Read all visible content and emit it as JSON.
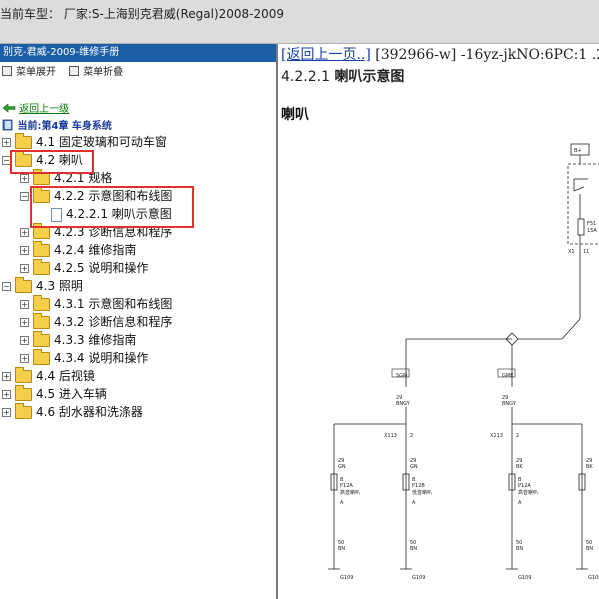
{
  "window": {
    "title": "当前车型：  厂家:S-上海别克君威(Regal)2008-2009"
  },
  "sidebar": {
    "header": "别克-君威-2009-维修手册",
    "expand_label": "菜单展开",
    "collapse_label": "菜单折叠",
    "back_label": "返回上一级",
    "current_label": "当前:第4章 车身系统",
    "tree": [
      {
        "label": "4.1 固定玻璃和可动车窗",
        "pm": "+"
      },
      {
        "label": "4.2 喇叭",
        "pm": "−"
      },
      {
        "label": "4.2.1 规格",
        "pm": "+"
      },
      {
        "label": "4.2.2 示意图和布线图",
        "pm": "−"
      },
      {
        "label": "4.2.2.1 喇叭示意图",
        "pm": ""
      },
      {
        "label": "4.2.3 诊断信息和程序",
        "pm": "+"
      },
      {
        "label": "4.2.4 维修指南",
        "pm": "+"
      },
      {
        "label": "4.2.5 说明和操作",
        "pm": "+"
      },
      {
        "label": "4.3 照明",
        "pm": "−"
      },
      {
        "label": "4.3.1 示意图和布线图",
        "pm": "+"
      },
      {
        "label": "4.3.2 诊断信息和程序",
        "pm": "+"
      },
      {
        "label": "4.3.3 维修指南",
        "pm": "+"
      },
      {
        "label": "4.3.4 说明和操作",
        "pm": "+"
      },
      {
        "label": "4.4 后视镜",
        "pm": "+"
      },
      {
        "label": "4.5 进入车辆",
        "pm": "+"
      },
      {
        "label": "4.6 刮水器和洗涤器",
        "pm": "+"
      }
    ]
  },
  "content": {
    "nav_link": "[返回上一页..]",
    "nav_info": " [392966-w] -16yz-jkNO:6PC:1 .2",
    "section_num": "4.2.2.1",
    "section_title": "喇叭示意图",
    "subtitle": "喇叭"
  },
  "diagram": {
    "b_plus": "B+",
    "fuse": "F51",
    "fuse_amp": "15A",
    "x1": "X1",
    "pin11": "11",
    "sgm": "SGM",
    "gme": "GME",
    "wire1": "29",
    "wire1_color": "BNGY",
    "x113": "X113",
    "pin2": "2",
    "p12a": "P12A",
    "p12b": "P12B",
    "horn_hi": "高音喇叭",
    "horn_lo": "低音喇叭",
    "pin_b": "B",
    "pin_a": "A",
    "gn": "GN",
    "bk": "BK",
    "w50": "50",
    "bn": "BN",
    "g109": "G109"
  }
}
